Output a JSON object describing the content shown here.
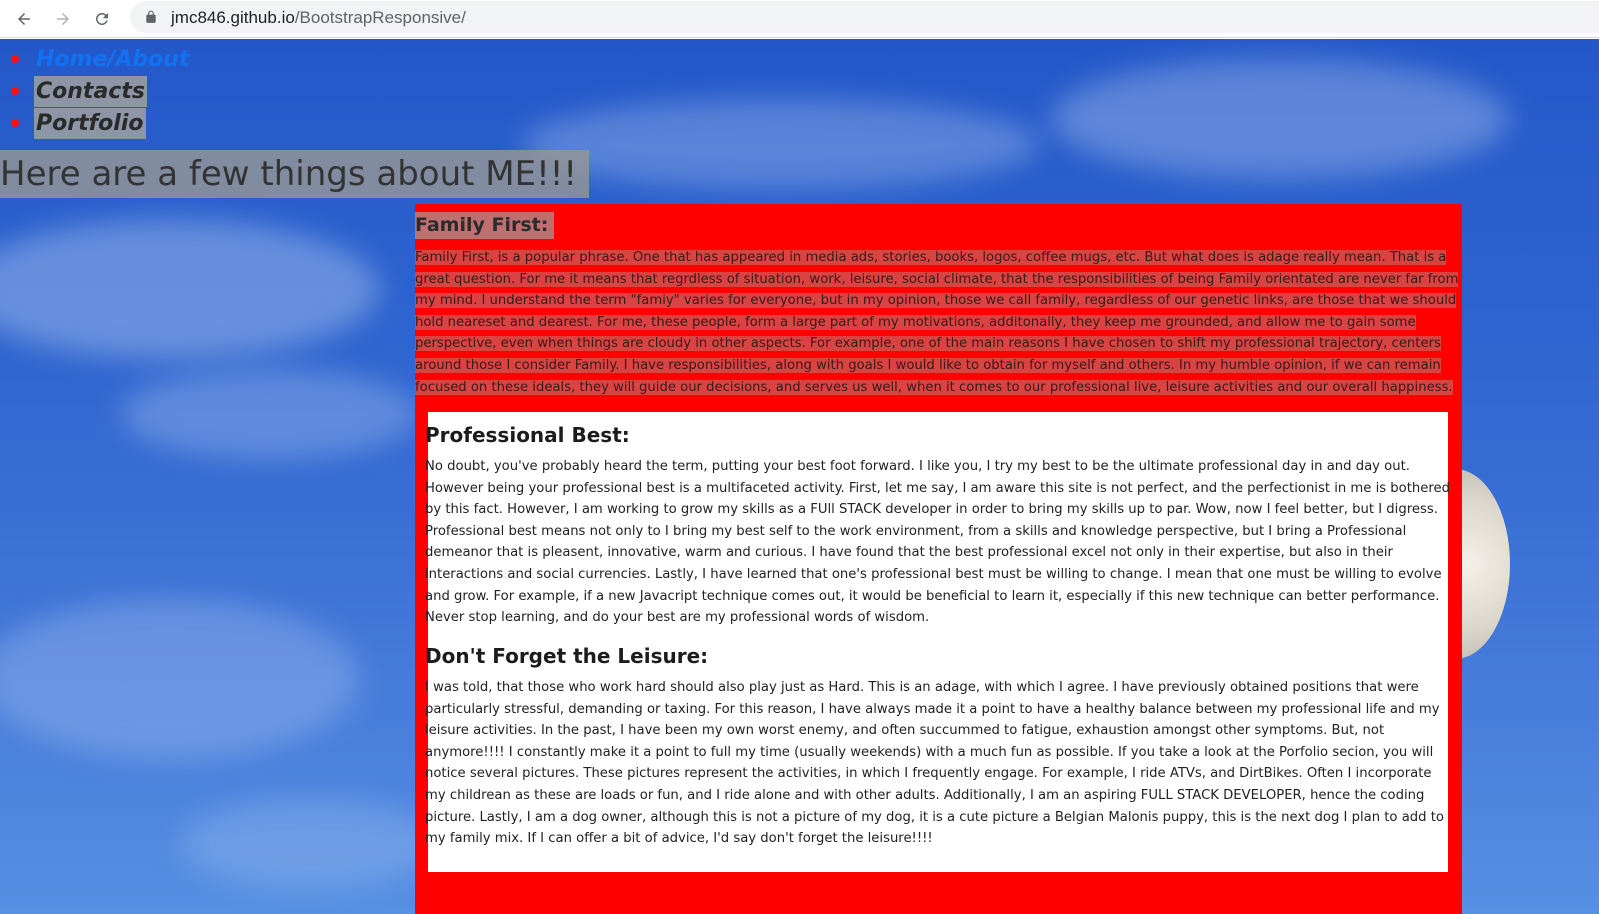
{
  "browser": {
    "url_host": "jmc846.github.io",
    "url_path": "/BootstrapResponsive/"
  },
  "nav": {
    "items": [
      {
        "label": "Home/About",
        "active": true
      },
      {
        "label": "Contacts",
        "active": false
      },
      {
        "label": "Portfolio",
        "active": false
      }
    ]
  },
  "hero": {
    "title": "Here are a few things about ME!!!"
  },
  "family": {
    "title": "Family First:",
    "text": "Family First, is a popular phrase. One that has appeared in media ads, stories, books, logos, coffee mugs, etc. But what does is adage really mean. That is a great question. For me it means that regrdless of situation, work, leisure, social climate, that the responsibilities of being Family orientated are never far from my mind. I understand the term \"famiy\" varies for everyone, but in my opinion, those we call family, regardless of our genetic links, are those that we should hold neareset and dearest. For me, these people, form a large part of my motivations, additonally, they keep me grounded, and allow me to gain some perspective, even when things are cloudy in other aspects. For example, one of the main reasons I have chosen to shift my professional trajectory, centers around those I consider Family. I have responsibilities, along with goals I would like to obtain for myself and others. In my humble opinion, if we can remain focused on these ideals, they will guide our decisions, and serves us well, when it comes to our professional live, leisure activities and our overall happiness."
  },
  "professional": {
    "title": "Professional Best:",
    "text": "No doubt, you've probably heard the term, putting your best foot forward. I like you, I try my best to be the ultimate professional day in and day out. However being your professional best is a multifaceted activity. First, let me say, I am aware this site is not perfect, and the perfectionist in me is bothered by this fact. However, I am working to grow my skills as a FUll STACK developer in order to bring my skills up to par. Wow, now I feel better, but I digress. Professional best means not only to I bring my best self to the work environment, from a skills and knowledge perspective, but I bring a Professional demeanor that is pleasent, innovative, warm and curious. I have found that the best professional excel not only in their expertise, but also in their interactions and social currencies. Lastly, I have learned that one's professional best must be willing to change. I mean that one must be willing to evolve and grow. For example, if a new Javacript technique comes out, it would be beneficial to learn it, especially if this new technique can better performance. Never stop learning, and do your best are my professional words of wisdom."
  },
  "leisure": {
    "title": "Don't Forget the Leisure:",
    "text": "I was told, that those who work hard should also play just as Hard. This is an adage, with which I agree. I have previously obtained positions that were particularly stressful, demanding or taxing. For this reason, I have always made it a point to have a healthy balance between my professional life and my leisure activities. In the past, I have been my own worst enemy, and often succummed to fatigue, exhaustion amongst other symptoms. But, not anymore!!!! I constantly make it a point to full my time (usually weekends) with a much fun as possible. If you take a look at the Porfolio secion, you will notice several pictures. These pictures represent the activities, in which I frequently engage. For example, I ride ATVs, and DirtBikes. Often I incorporate my childrean as these are loads or fun, and I ride alone and with other adults. Additionally, I am an aspiring FULL STACK DEVELOPER, hence the coding picture. Lastly, I am a dog owner, although this is not a picture of my dog, it is a cute picture a Belgian Malonis puppy, this is the next dog I plan to add to my family mix. If I can offer a bit of advice, I'd say don't forget the leisure!!!!"
  },
  "colors": {
    "card_background": "#ff0000",
    "link_active": "#1272f2",
    "bullet": "#ff1010"
  }
}
